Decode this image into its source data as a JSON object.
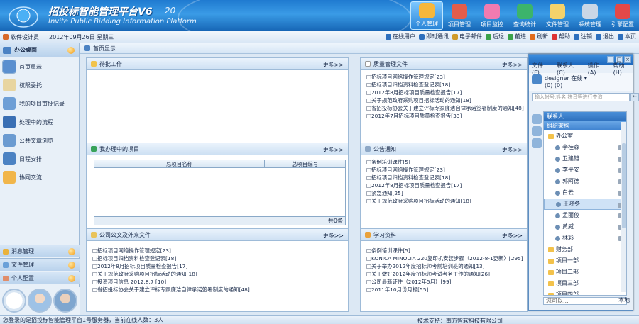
{
  "app": {
    "title": "招投标智能管理平台V6",
    "version": "20",
    "subtitle": "Invite Public Bidding Information Platform"
  },
  "topnav": [
    {
      "label": "个人管理",
      "color": "#f6b73c",
      "active": true
    },
    {
      "label": "项目管理",
      "color": "#e35d4b"
    },
    {
      "label": "项目监控",
      "color": "#f07bb0"
    },
    {
      "label": "查询统计",
      "color": "#3cb46b"
    },
    {
      "label": "文件管理",
      "color": "#f4d26a"
    },
    {
      "label": "系统管理",
      "color": "#c9d7e6"
    },
    {
      "label": "引擎配置",
      "color": "#e34848"
    }
  ],
  "toolbar": {
    "user": "软件设计员",
    "date": "2012年09月26日  星期三",
    "actions": [
      {
        "label": "在线用户",
        "color": "#2d6fbd"
      },
      {
        "label": "即时通讯",
        "color": "#2d6fbd"
      },
      {
        "label": "电子邮件",
        "color": "#d09b2a"
      },
      {
        "label": "后退",
        "color": "#3aa24a"
      },
      {
        "label": "前进",
        "color": "#3aa24a"
      },
      {
        "label": "刷新",
        "color": "#e06a1a"
      },
      {
        "label": "帮助",
        "color": "#d33"
      },
      {
        "label": "注销",
        "color": "#2d6fbd"
      },
      {
        "label": "退出",
        "color": "#2d6fbd"
      },
      {
        "label": "本页",
        "color": "#2d6fbd"
      }
    ]
  },
  "sidebar": {
    "header": "办公桌面",
    "items": [
      {
        "label": "首页显示",
        "color": "#5a8fcf",
        "active": true
      },
      {
        "label": "权限委托",
        "color": "#e8d5a0"
      },
      {
        "label": "我的项目审批记录",
        "color": "#6e9fd6"
      },
      {
        "label": "处理中的流程",
        "color": "#3a6fb4"
      },
      {
        "label": "公共文章浏览",
        "color": "#6b9bd1"
      },
      {
        "label": "日程安排",
        "color": "#4b82c3"
      },
      {
        "label": "协同交流",
        "color": "#f1b64b"
      }
    ],
    "bottom": [
      {
        "label": "消息管理",
        "color": "#e9b23c"
      },
      {
        "label": "文件管理",
        "color": "#6aa0d8"
      },
      {
        "label": "个人配置",
        "color": "#e08d6a"
      }
    ]
  },
  "breadcrumb": "首页显示",
  "panels": {
    "pending": {
      "title": "待批工作",
      "more": "更多>>"
    },
    "quality": {
      "title": "质量管理文件",
      "more": "更多>>",
      "items": [
        "□招标项目网络操作管理规定[23]",
        "□招标项目归档资料检查登记表[18]",
        "□2012年8月招标项目质量检查报告[17]",
        "□关于规范政府采购项目招标活动的通知[18]",
        "□省招投标协会关于建立评标专家廉洁自律承诺签署制度的通知[48]",
        "□2012年7月招标项目质量检查报告[33]"
      ]
    },
    "myprojects": {
      "title": "我办理中的项目",
      "more": "更多>>",
      "columns": [
        "总项目名称",
        "总项目编号"
      ],
      "footer": "共0条"
    },
    "notice": {
      "title": "公告通知",
      "more": "更多>>",
      "items": [
        "□条例培训课件[5]",
        "□招标项目网络操作管理规定[23]",
        "□招标项目归档资料检查登记表[18]",
        "□2012年8月招标项目质量检查报告[17]",
        "□紧急通知[25]",
        "□关于规范政府采购项目招标活动的通知[18]"
      ]
    },
    "official": {
      "title": "公司公文及外来文件",
      "more": "更多>>",
      "items": [
        "□招标项目网络操作管理规定[23]",
        "□招标项目归档资料检查登记表[18]",
        "□2012年8月招标项目质量检查报告[17]",
        "□关于规范政府采购项目招标活动的通知[18]",
        "□投资项目信息 2012.8.7 [10]",
        "□省招投标协会关于建立评标专家廉洁自律承诺签署制度的通知[48]"
      ]
    },
    "learning": {
      "title": "学习资料",
      "more": "更多>>",
      "items": [
        "□条例培训课件[5]",
        "□KONICA MINOLTA 220复印机安装步骤（2012-8-1更新）[295]",
        "□关于举办2012年度招标师考前培训班的通知[13]",
        "□关于做好2012年度招标师考试考务工作的通知[26]",
        "□公司最新证件（2012年5月）[99]",
        "□2011年10月份月报[55]"
      ]
    }
  },
  "status": {
    "left": "您登录的是招投标智能管理平台1号服务器，当前在线人数：3人",
    "right": "技术支持：南方智软科技有限公司"
  },
  "im": {
    "menu": [
      "文件(F)",
      "联系人(C)",
      "操作(A)",
      "帮助(H)"
    ],
    "user": "designer 在线 ▾",
    "counts": "(0)   (0)",
    "search_placeholder": "输入帐号,姓名,拼音等进行查询",
    "sections": [
      "联系人",
      "组织架构"
    ],
    "tree": [
      {
        "label": "办公室",
        "type": "folder"
      },
      {
        "label": "李桂森",
        "type": "person"
      },
      {
        "label": "卫建雄",
        "type": "person"
      },
      {
        "label": "李平安",
        "type": "person"
      },
      {
        "label": "郭阿德",
        "type": "person"
      },
      {
        "label": "白云",
        "type": "person"
      },
      {
        "label": "王晓冬",
        "type": "person",
        "selected": true
      },
      {
        "label": "孟丽俊",
        "type": "person"
      },
      {
        "label": "黄威",
        "type": "person"
      },
      {
        "label": "林彩",
        "type": "person"
      },
      {
        "label": "财务部",
        "type": "folder"
      },
      {
        "label": "项目一部",
        "type": "folder"
      },
      {
        "label": "项目二部",
        "type": "folder"
      },
      {
        "label": "项目三部",
        "type": "folder"
      },
      {
        "label": "项目四部",
        "type": "folder"
      }
    ],
    "bottom_placeholder": "您可以...",
    "home": "本地"
  }
}
